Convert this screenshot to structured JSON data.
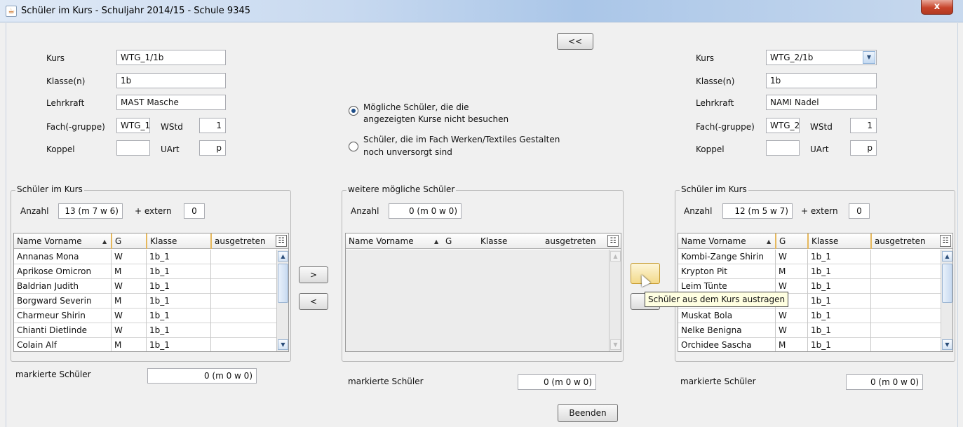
{
  "window": {
    "title": "Schüler im Kurs - Schuljahr 2014/15 - Schule 9345",
    "icon": "java-cup-icon",
    "close_label": "x"
  },
  "top_button": "<<",
  "left_course": {
    "kurs_label": "Kurs",
    "kurs": "WTG_1/1b",
    "klasse_label": "Klasse(n)",
    "klasse": "1b",
    "lehrkraft_label": "Lehrkraft",
    "lehrkraft": "MAST Masche",
    "fach_label": "Fach(-gruppe)",
    "fach": "WTG_1",
    "wstd_label": "WStd",
    "wstd": "1",
    "koppel_label": "Koppel",
    "koppel": "",
    "uart_label": "UArt",
    "uart": "p"
  },
  "right_course": {
    "kurs_label": "Kurs",
    "kurs": "WTG_2/1b",
    "klasse_label": "Klasse(n)",
    "klasse": "1b",
    "lehrkraft_label": "Lehrkraft",
    "lehrkraft": "NAMI Nadel",
    "fach_label": "Fach(-gruppe)",
    "fach": "WTG_2",
    "wstd_label": "WStd",
    "wstd": "1",
    "koppel_label": "Koppel",
    "koppel": "",
    "uart_label": "UArt",
    "uart": "p"
  },
  "options": {
    "option1_line1": "Mögliche Schüler, die die",
    "option1_line2": "angezeigten Kurse nicht besuchen",
    "option2_line1": "Schüler, die im Fach Werken/Textiles Gestalten",
    "option2_line2": "noch unversorgt sind",
    "selected": 1
  },
  "left_panel": {
    "title": "Schüler im Kurs",
    "anzahl_label": "Anzahl",
    "anzahl": "13 (m 7 w 6)",
    "extern_label": "+ extern",
    "extern": "0",
    "columns": [
      "Name Vorname",
      "G",
      "Klasse",
      "ausgetreten"
    ],
    "rows": [
      [
        "Annanas Mona",
        "W",
        "1b_1",
        ""
      ],
      [
        "Aprikose Omicron",
        "M",
        "1b_1",
        ""
      ],
      [
        "Baldrian Judith",
        "W",
        "1b_1",
        ""
      ],
      [
        "Borgward Severin",
        "M",
        "1b_1",
        ""
      ],
      [
        "Charmeur Shirin",
        "W",
        "1b_1",
        ""
      ],
      [
        "Chianti Dietlinde",
        "W",
        "1b_1",
        ""
      ],
      [
        "Colain Alf",
        "M",
        "1b_1",
        ""
      ]
    ],
    "marked_label": "markierte Schüler",
    "marked": "0 (m 0 w 0)"
  },
  "middle_panel": {
    "title": "weitere mögliche Schüler",
    "anzahl_label": "Anzahl",
    "anzahl": "0 (m 0 w 0)",
    "columns": [
      "Name Vorname",
      "G",
      "Klasse",
      "ausgetreten"
    ],
    "rows": [],
    "marked_label": "markierte Schüler",
    "marked": "0 (m 0 w 0)"
  },
  "right_panel": {
    "title": "Schüler im Kurs",
    "anzahl_label": "Anzahl",
    "anzahl": "12 (m 5 w 7)",
    "extern_label": "+ extern",
    "extern": "0",
    "columns": [
      "Name Vorname",
      "G",
      "Klasse",
      "ausgetreten"
    ],
    "rows": [
      [
        "Kombi-Zange Shirin",
        "W",
        "1b_1",
        ""
      ],
      [
        "Krypton Pit",
        "M",
        "1b_1",
        ""
      ],
      [
        "Leim Tünte",
        "W",
        "1b_1",
        ""
      ],
      [
        "",
        "",
        "1b_1",
        ""
      ],
      [
        "Muskat Bola",
        "W",
        "1b_1",
        ""
      ],
      [
        "Nelke Benigna",
        "W",
        "1b_1",
        ""
      ],
      [
        "Orchidee Sascha",
        "M",
        "1b_1",
        ""
      ]
    ],
    "marked_label": "markierte Schüler",
    "marked": "0 (m 0 w 0)"
  },
  "move_buttons": {
    "left_add": ">",
    "left_remove": "<",
    "right_add": "",
    "right_remove": ""
  },
  "tooltip": "Schüler aus dem Kurs austragen",
  "beenden": "Beenden"
}
